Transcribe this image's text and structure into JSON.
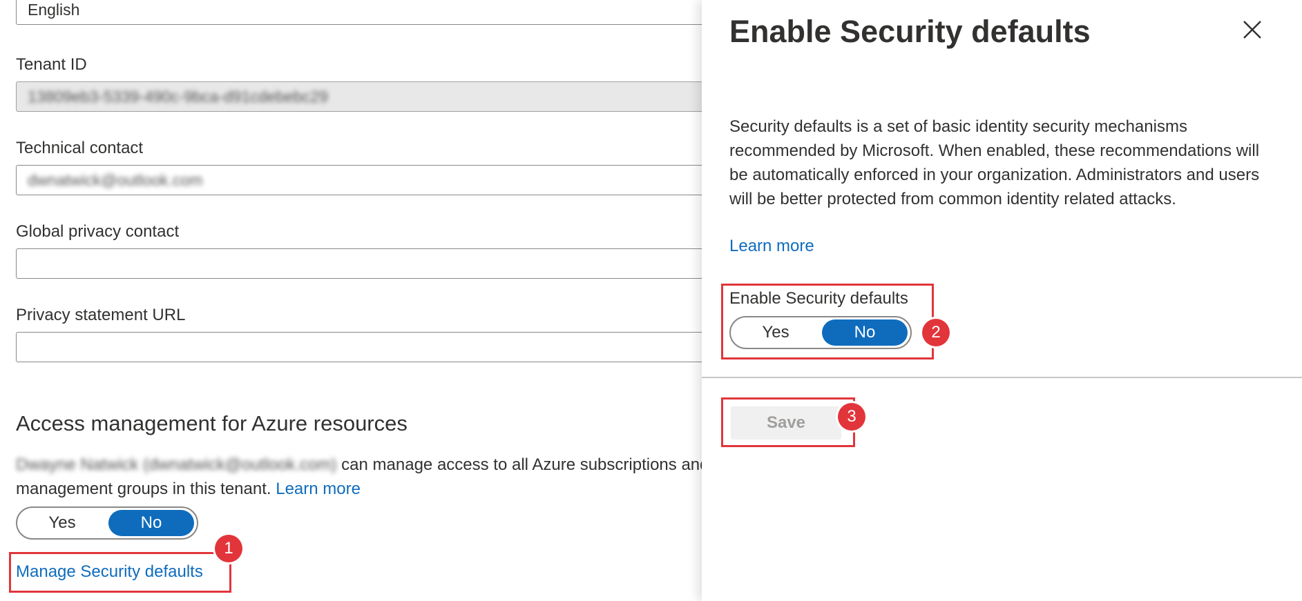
{
  "left": {
    "language_value": "English",
    "tenant_id": {
      "label": "Tenant ID",
      "value": "13809eb3-5339-490c-9bca-d91cdebebc29"
    },
    "technical_contact": {
      "label": "Technical contact",
      "value": "dwnatwick@outlook.com"
    },
    "global_privacy_contact": {
      "label": "Global privacy contact",
      "value": ""
    },
    "privacy_statement_url": {
      "label": "Privacy statement URL",
      "value": ""
    },
    "access_section": {
      "title": "Access management for Azure resources",
      "user_blurred": "Dwayne Natwick (dwnatwick@outlook.com)",
      "desc_text": " can manage access to all Azure subscriptions and management groups in this tenant. ",
      "learn_more": "Learn more",
      "toggle": {
        "yes": "Yes",
        "no": "No",
        "selected": "No"
      }
    },
    "manage_link": "Manage Security defaults"
  },
  "panel": {
    "title": "Enable Security defaults",
    "description": "Security defaults is a set of basic identity security mechanisms recommended by Microsoft. When enabled, these recommendations will be automatically enforced in your organization. Administrators and users will be better protected from common identity related attacks.",
    "learn_more": "Learn more",
    "toggle_label": "Enable Security defaults",
    "toggle": {
      "yes": "Yes",
      "no": "No",
      "selected": "No"
    },
    "save_label": "Save"
  },
  "callouts": [
    "1",
    "2",
    "3"
  ],
  "colors": {
    "accent": "#0f6cbd",
    "callout": "#e1353b"
  }
}
